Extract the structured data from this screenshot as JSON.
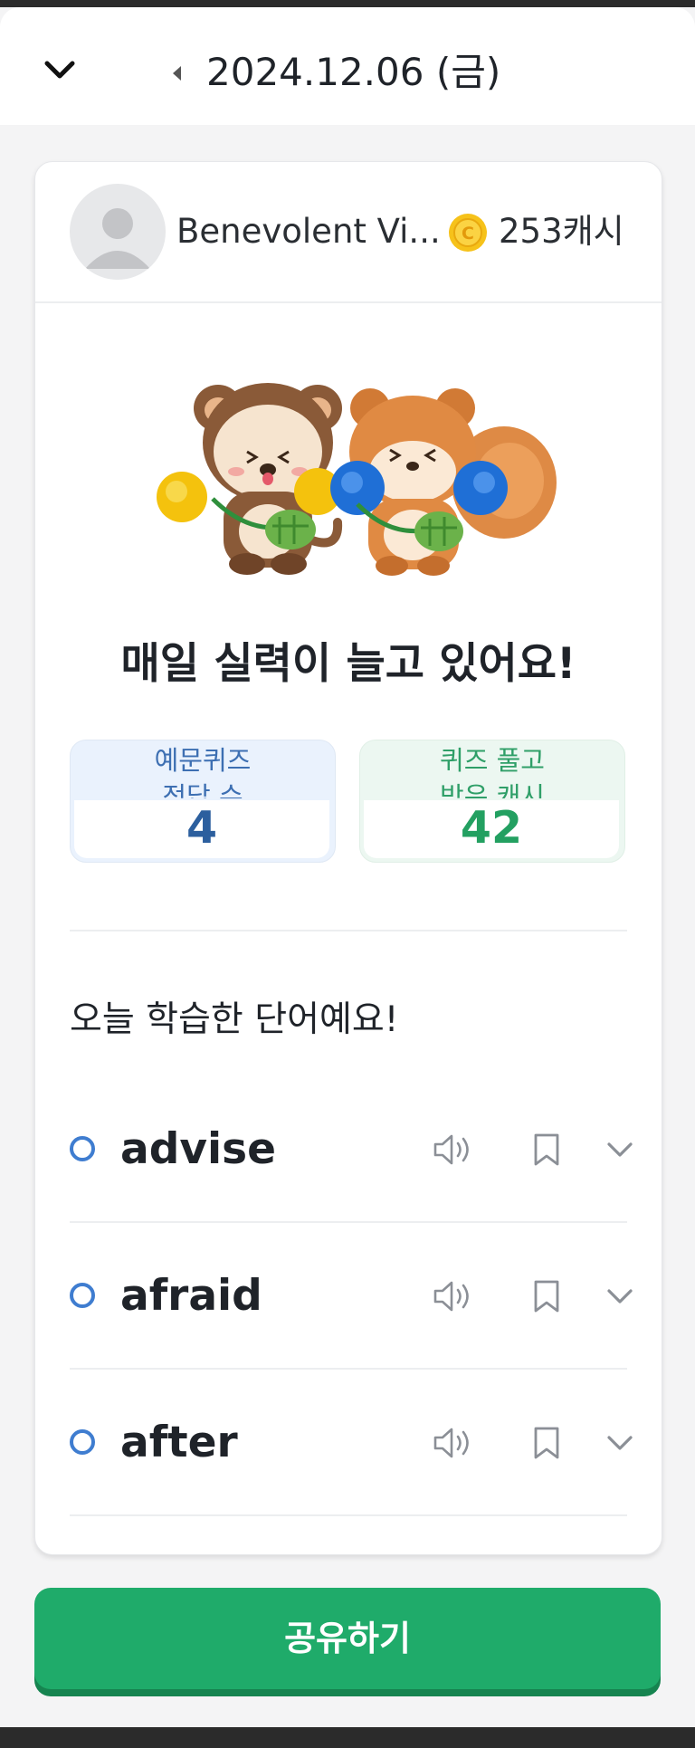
{
  "header": {
    "date": "2024.12.06 (금)",
    "collapse_icon": "chevron-down-icon",
    "prev_icon": "caret-left-icon"
  },
  "profile": {
    "username": "Benevolent Vi...",
    "coin_icon": "coin-icon",
    "cash": "253캐시"
  },
  "result": {
    "headline": "매일 실력이 늘고 있어요!",
    "stats": [
      {
        "label": "예문퀴즈\n정답 수",
        "value": "4",
        "color": "#2c5f9e"
      },
      {
        "label": "퀴즈 풀고\n받은 캐시",
        "value": "42",
        "color": "#23a061"
      }
    ]
  },
  "words_section": {
    "title": "오늘 학습한 단어예요!",
    "words": [
      {
        "word": "advise"
      },
      {
        "word": "afraid"
      },
      {
        "word": "after"
      }
    ],
    "icons": [
      "speaker-icon",
      "bookmark-icon",
      "chevron-down-icon"
    ]
  },
  "share_button": {
    "label": "공유하기",
    "color": "#1fab6a"
  }
}
